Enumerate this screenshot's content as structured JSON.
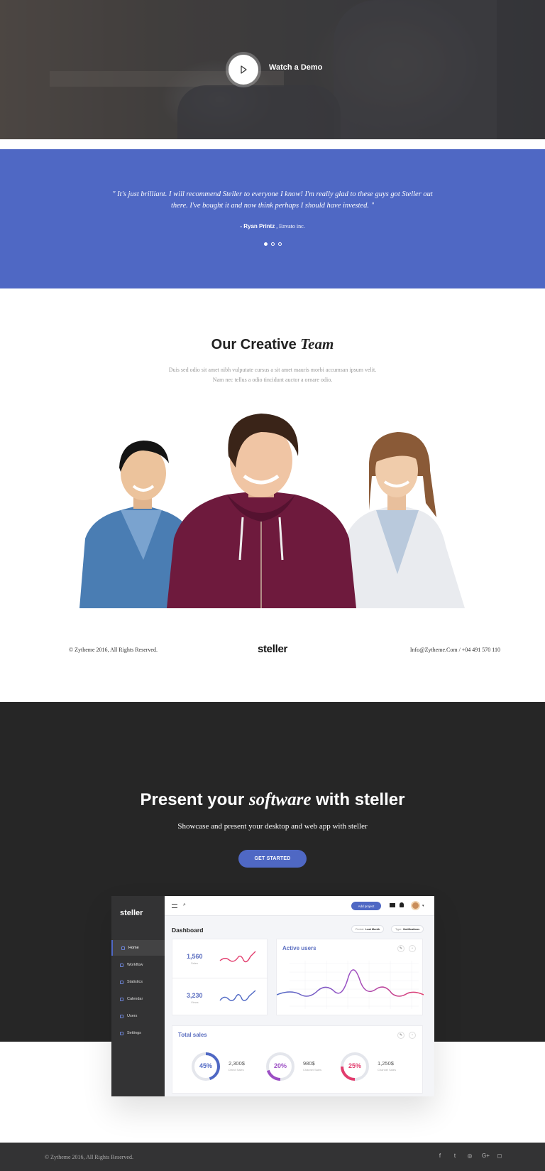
{
  "hero": {
    "watch_label": "Watch a Demo"
  },
  "testimonial": {
    "quote": "\" It's just brilliant. I will recommend Steller to everyone I know! I'm really glad to these guys got Steller out there. I've bought it and now think perhaps I should have invested. \"",
    "author_name": "- Ryan Printz",
    "author_company": " , Envato inc.",
    "dots": 3,
    "active_dot": 0
  },
  "team": {
    "title_plain": "Our Creative ",
    "title_emphasis": "Team",
    "description": "Duis sed odio sit amet nibh vulputate cursus a sit amet mauris morbi accumsan ipsum velit. Nam nec tellus a odio tincidunt auctor a ornare odio."
  },
  "footer_line": {
    "copyright": "© Zytheme 2016, All Rights Reserved.",
    "logo": "steller",
    "contact": "Info@Zytheme.Com / +04 491 570 110"
  },
  "software": {
    "title_before": "Present your ",
    "title_emphasis": "software",
    "title_after": " with steller",
    "subtitle": "Showcase and present your desktop and web app with steller",
    "cta_label": "GET STARTED"
  },
  "dashboard": {
    "brand": "steller",
    "nav": [
      {
        "label": "Home",
        "icon": "home-icon",
        "active": true
      },
      {
        "label": "Workflow",
        "icon": "grid-icon",
        "active": false
      },
      {
        "label": "Statistics",
        "icon": "check-icon",
        "active": false
      },
      {
        "label": "Calendar",
        "icon": "calendar-icon",
        "active": false
      },
      {
        "label": "Users",
        "icon": "user-icon",
        "active": false
      },
      {
        "label": "Settings",
        "icon": "settings-icon",
        "active": false
      }
    ],
    "add_project_label": "Add project",
    "heading": "Dashboard",
    "period_label": "Period:",
    "period_value": "Last Month",
    "type_label": "Type:",
    "type_value": "Notifications",
    "stats": [
      {
        "value": "1,560",
        "label": "Sales",
        "color": "#e23c6d"
      },
      {
        "value": "3,230",
        "label": "Views",
        "color": "#4f68c4"
      }
    ],
    "active_users_title": "Active users",
    "total_sales_title": "Total sales",
    "donuts": [
      {
        "percent": 45,
        "value": "2,300$",
        "label": "Direct Sales",
        "color": "#4f68c4"
      },
      {
        "percent": 20,
        "value": "980$",
        "label": "Channel Sales",
        "color": "#9c4fc4"
      },
      {
        "percent": 25,
        "value": "1,250$",
        "label": "Channel Sales",
        "color": "#e23c6d"
      }
    ],
    "donut_labels": [
      "45%",
      "20%",
      "25%"
    ]
  },
  "bottom_footer": {
    "copyright": "© Zytheme 2016, All Rights Reserved.",
    "social": [
      {
        "glyph": "f",
        "icon": "facebook-icon"
      },
      {
        "glyph": "t",
        "icon": "twitter-icon"
      },
      {
        "glyph": "◎",
        "icon": "dribbble-icon"
      },
      {
        "glyph": "G+",
        "icon": "google-plus-icon"
      },
      {
        "glyph": "◻",
        "icon": "instagram-icon"
      }
    ]
  },
  "colors": {
    "accent": "#4f68c4",
    "dark": "#262626",
    "footer": "#333334"
  }
}
